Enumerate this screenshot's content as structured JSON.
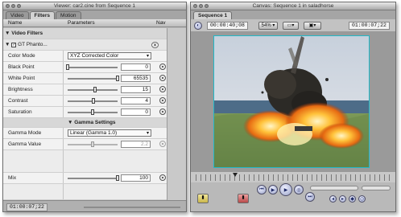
{
  "viewer": {
    "title": "Viewer: car2.cine from Sequence 1",
    "tabs": [
      "Video",
      "Filters",
      "Motion"
    ],
    "headers": {
      "name": "Name",
      "parameters": "Parameters",
      "nav": "Nav"
    },
    "group_label": "Video Filters",
    "filter_name": "GT Phanto...",
    "params": {
      "color_mode": {
        "label": "Color Mode",
        "value": "XYZ Corrected Color"
      },
      "black_point": {
        "label": "Black Point",
        "value": "0",
        "level": 0.0
      },
      "white_point": {
        "label": "White Point",
        "value": "65535",
        "level": 1.0
      },
      "brightness": {
        "label": "Brightness",
        "value": "15",
        "level": 0.55
      },
      "contrast": {
        "label": "Contrast",
        "value": "4",
        "level": 0.52
      },
      "saturation": {
        "label": "Saturation",
        "value": "0",
        "level": 0.5
      },
      "gamma_section": "Gamma Settings",
      "gamma_mode": {
        "label": "Gamma Mode",
        "value": "Linear (Gamma 1.0)"
      },
      "gamma_value": {
        "label": "Gamma Value",
        "value": "2.2",
        "level": 0.5
      },
      "mix": {
        "label": "Mix",
        "value": "100",
        "level": 1.0
      }
    },
    "timecode": "01:00:07;22"
  },
  "canvas": {
    "title": "Canvas: Sequence 1 in saladhorse",
    "tab": "Sequence 1",
    "duration": "00:00:40;08",
    "zoom": "54%",
    "timecode": "01:00:07;22"
  },
  "colors": {
    "accent": "#1f2a66",
    "panel": "#bdbdbd",
    "video_border": "#22b8c8"
  }
}
